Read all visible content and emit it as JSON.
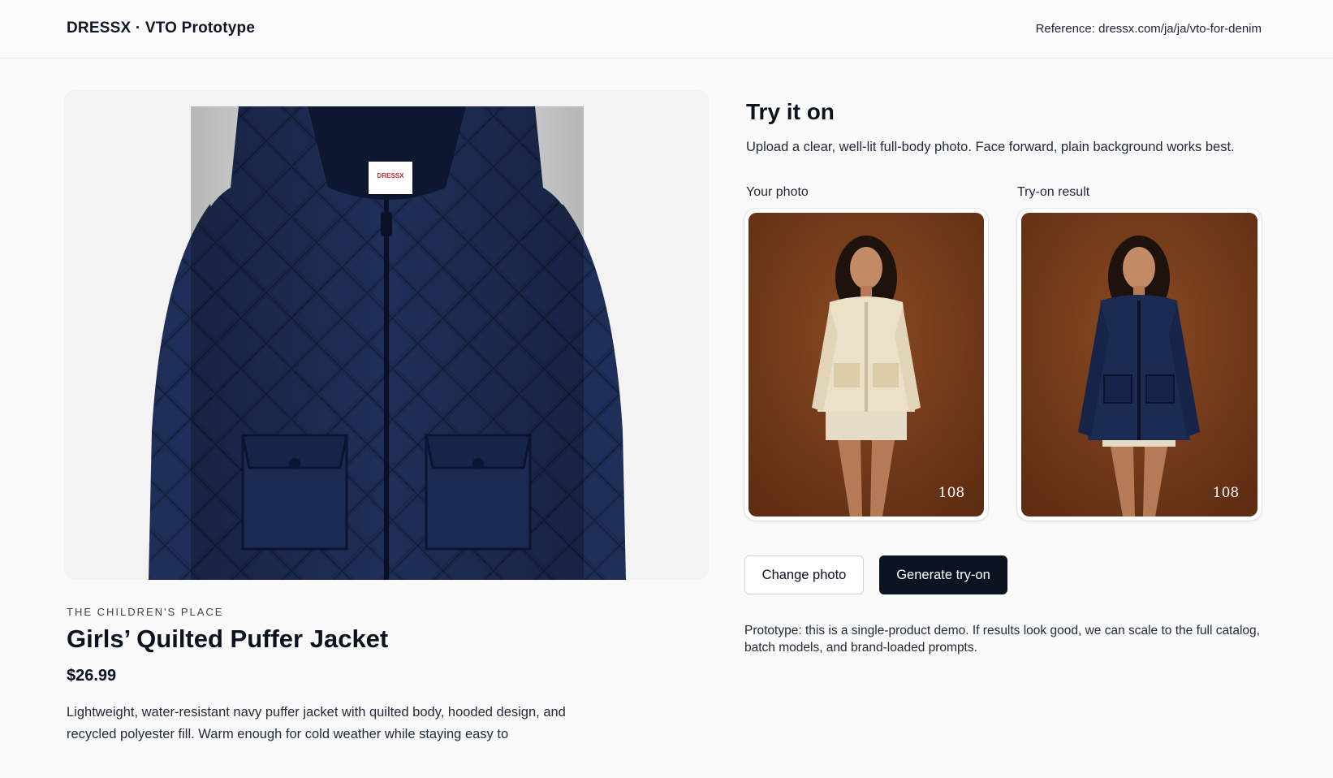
{
  "header": {
    "brand": "DRESSX · VTO Prototype",
    "reference": "Reference: dressx.com/ja/ja/vto-for-denim"
  },
  "product": {
    "image_icon": "jacket-product-image",
    "tag_label": "DRESSX",
    "brand": "THE CHILDREN'S PLACE",
    "title": "Girls’ Quilted Puffer Jacket",
    "price": "$26.99",
    "description": "Lightweight, water-resistant navy puffer jacket with quilted body, hooded design, and recycled polyester fill. Warm enough for cold weather while staying easy to"
  },
  "tryon": {
    "title": "Try it on",
    "subtitle": "Upload a clear, well-lit full-body photo. Face forward, plain background works best.",
    "your_photo_label": "Your photo",
    "result_label": "Try-on result",
    "photo_watermark": "108",
    "result_watermark": "108",
    "change_button": "Change photo",
    "generate_button": "Generate try-on",
    "note": "Prototype: this is a single-product demo. If results look good, we can scale to the full catalog, batch models, and brand-loaded prompts."
  },
  "colors": {
    "accent": "#0c1424",
    "jacket": "#1c2b52",
    "photo_bg": "#7a3f1e",
    "cream_jacket": "#ece0c8"
  }
}
